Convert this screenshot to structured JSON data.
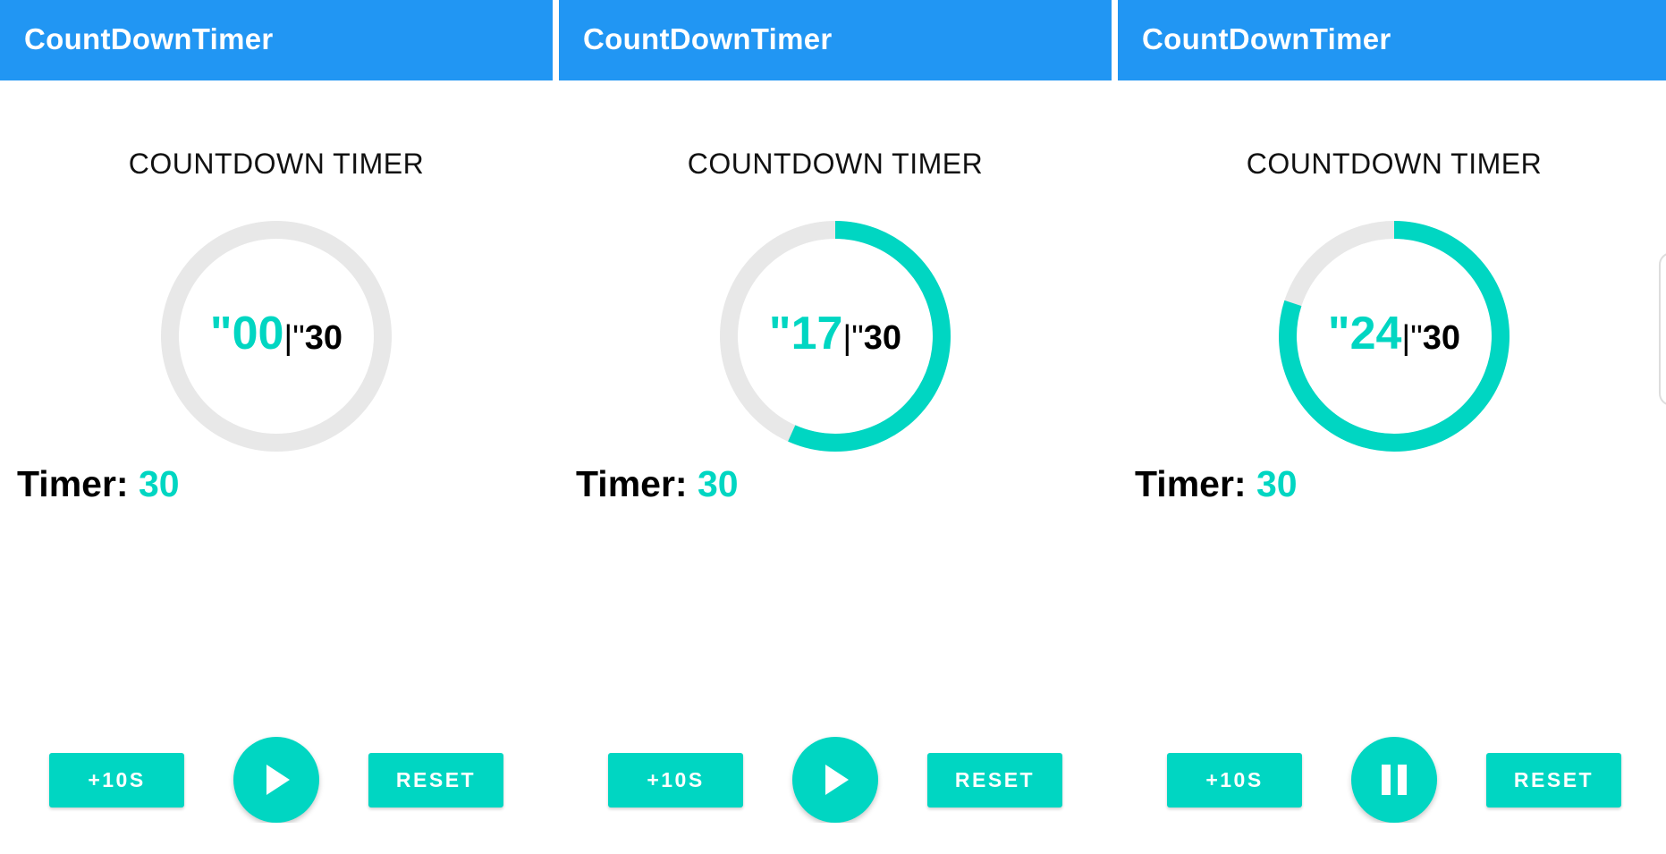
{
  "colors": {
    "appbar": "#2196f3",
    "accent": "#00d6c2",
    "track": "#e8e8e8"
  },
  "screens": [
    {
      "appbar_title": "CountDownTimer",
      "heading": "COUNTDOWN TIMER",
      "current": "\"00",
      "separator": "|\"",
      "total": "30",
      "progress": 0,
      "timer_label": "Timer: ",
      "timer_value": "30",
      "add_label": "+10S",
      "play_state": "play",
      "play_icon": "play-icon",
      "reset_label": "RESET"
    },
    {
      "appbar_title": "CountDownTimer",
      "heading": "COUNTDOWN TIMER",
      "current": "\"17",
      "separator": "|\"",
      "total": "30",
      "progress": 0.567,
      "timer_label": "Timer: ",
      "timer_value": "30",
      "add_label": "+10S",
      "play_state": "play",
      "play_icon": "play-icon",
      "reset_label": "RESET"
    },
    {
      "appbar_title": "CountDownTimer",
      "heading": "COUNTDOWN TIMER",
      "current": "\"24",
      "separator": "|\"",
      "total": "30",
      "progress": 0.8,
      "timer_label": "Timer: ",
      "timer_value": "30",
      "add_label": "+10S",
      "play_state": "pause",
      "play_icon": "pause-icon",
      "reset_label": "RESET"
    }
  ]
}
